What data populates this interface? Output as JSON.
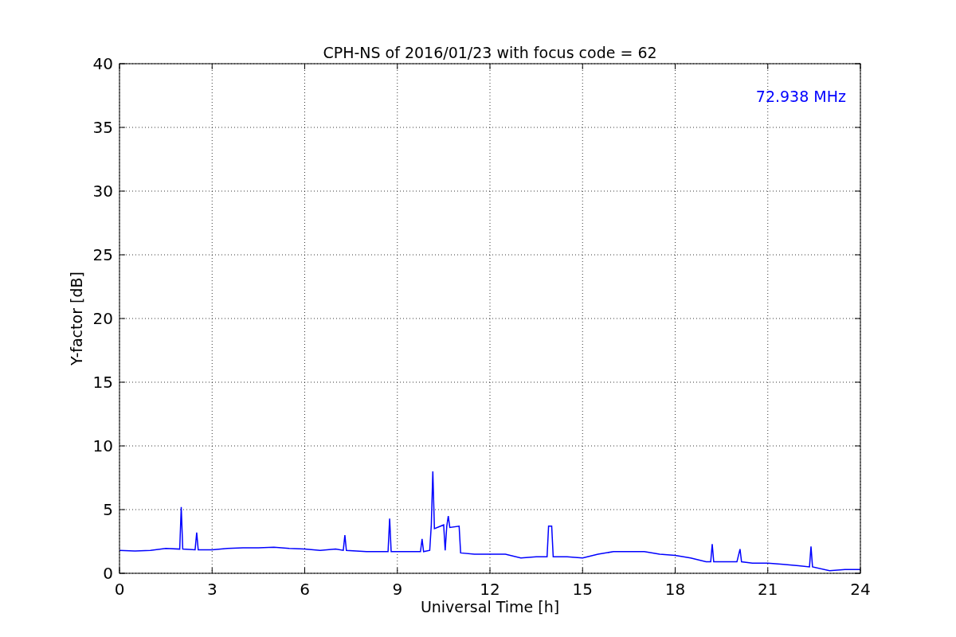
{
  "figure": {
    "chart_data": {
      "type": "line",
      "title": "CPH-NS of 2016/01/23 with focus code = 62",
      "xlabel": "Universal Time [h]",
      "ylabel": "Y-factor [dB]",
      "x": [
        0,
        0.5,
        1,
        1.5,
        1.95,
        2.0,
        2.05,
        2.45,
        2.5,
        2.55,
        3,
        3.5,
        4,
        4.5,
        5,
        5.5,
        6,
        6.5,
        7,
        7.25,
        7.3,
        7.35,
        8,
        8.5,
        8.7,
        8.75,
        8.8,
        9.5,
        9.75,
        9.8,
        9.85,
        10.05,
        10.1,
        10.15,
        10.2,
        10.5,
        10.55,
        10.6,
        10.65,
        10.7,
        11.0,
        11.05,
        11.5,
        12,
        12.5,
        13,
        13.5,
        13.85,
        13.9,
        14.0,
        14.05,
        14.5,
        15,
        15.5,
        16,
        16.5,
        17,
        17.5,
        18,
        18.5,
        19,
        19.15,
        19.2,
        19.25,
        20,
        20.1,
        20.15,
        20.5,
        21,
        21.5,
        22,
        22.35,
        22.4,
        22.45,
        23,
        23.5,
        24
      ],
      "series": [
        {
          "color": "#0000ff",
          "values": [
            1.8,
            1.75,
            1.8,
            1.95,
            1.9,
            5.2,
            1.9,
            1.85,
            3.2,
            1.85,
            1.85,
            1.95,
            2.0,
            2.0,
            2.05,
            1.95,
            1.9,
            1.8,
            1.9,
            1.8,
            3.0,
            1.8,
            1.7,
            1.7,
            1.7,
            4.3,
            1.7,
            1.7,
            1.7,
            2.7,
            1.7,
            1.8,
            3.8,
            8.0,
            3.5,
            3.8,
            1.8,
            3.7,
            4.5,
            3.6,
            3.7,
            1.6,
            1.5,
            1.5,
            1.5,
            1.2,
            1.3,
            1.3,
            3.7,
            3.7,
            1.3,
            1.3,
            1.2,
            1.5,
            1.7,
            1.7,
            1.7,
            1.5,
            1.4,
            1.2,
            0.9,
            0.9,
            2.3,
            0.9,
            0.9,
            1.9,
            0.9,
            0.8,
            0.8,
            0.7,
            0.6,
            0.5,
            2.1,
            0.5,
            0.2,
            0.3,
            0.3
          ]
        }
      ],
      "xlim": [
        0,
        24
      ],
      "ylim": [
        0,
        40
      ],
      "xticks": [
        0,
        3,
        6,
        9,
        12,
        15,
        18,
        21,
        24
      ],
      "yticks": [
        0,
        5,
        10,
        15,
        20,
        25,
        30,
        35,
        40
      ],
      "grid": true,
      "annotations": [
        "72.938 MHz"
      ]
    }
  }
}
